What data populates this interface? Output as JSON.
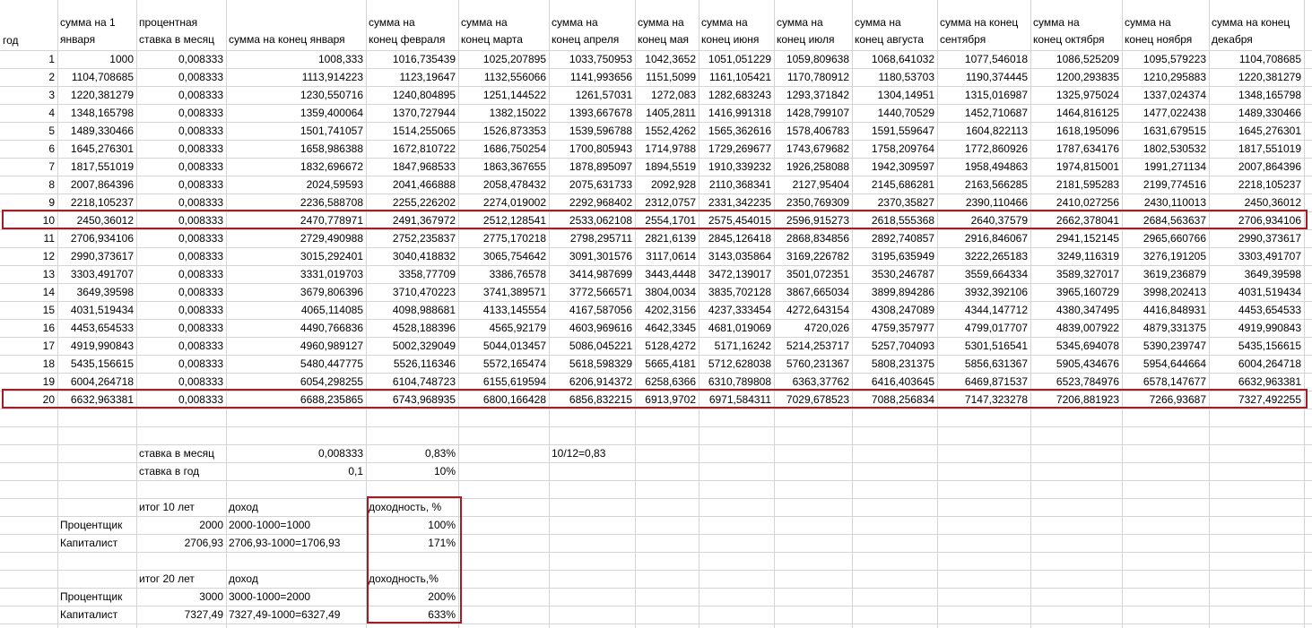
{
  "header": {
    "year": "год",
    "start": [
      "сумма на 1",
      "января"
    ],
    "rate": [
      "процентная",
      "ставка в месяц"
    ],
    "jan": [
      "",
      "сумма на конец января"
    ],
    "months": [
      [
        "сумма на",
        "конец февраля"
      ],
      [
        "сумма на",
        "конец марта"
      ],
      [
        "сумма на",
        "конец апреля"
      ],
      [
        "сумма на",
        "конец мая"
      ],
      [
        "сумма на",
        "конец июня"
      ],
      [
        "сумма на",
        "конец июля"
      ],
      [
        "сумма на",
        "конец августа"
      ],
      [
        "сумма на конец",
        "сентября"
      ],
      [
        "сумма на",
        "конец октября"
      ],
      [
        "сумма на",
        "конец ноября"
      ],
      [
        "сумма на конец",
        "декабря"
      ]
    ]
  },
  "rows": [
    [
      "1",
      "1000",
      "0,008333",
      "1008,333",
      "1016,735439",
      "1025,207895",
      "1033,750953",
      "1042,3652",
      "1051,051229",
      "1059,809638",
      "1068,641032",
      "1077,546018",
      "1086,525209",
      "1095,579223",
      "1104,708685"
    ],
    [
      "2",
      "1104,708685",
      "0,008333",
      "1113,914223",
      "1123,19647",
      "1132,556066",
      "1141,993656",
      "1151,5099",
      "1161,105421",
      "1170,780912",
      "1180,53703",
      "1190,374445",
      "1200,293835",
      "1210,295883",
      "1220,381279"
    ],
    [
      "3",
      "1220,381279",
      "0,008333",
      "1230,550716",
      "1240,804895",
      "1251,144522",
      "1261,57031",
      "1272,083",
      "1282,683243",
      "1293,371842",
      "1304,14951",
      "1315,016987",
      "1325,975024",
      "1337,024374",
      "1348,165798"
    ],
    [
      "4",
      "1348,165798",
      "0,008333",
      "1359,400064",
      "1370,727944",
      "1382,15022",
      "1393,667678",
      "1405,2811",
      "1416,991318",
      "1428,799107",
      "1440,70529",
      "1452,710687",
      "1464,816125",
      "1477,022438",
      "1489,330466"
    ],
    [
      "5",
      "1489,330466",
      "0,008333",
      "1501,741057",
      "1514,255065",
      "1526,873353",
      "1539,596788",
      "1552,4262",
      "1565,362616",
      "1578,406783",
      "1591,559647",
      "1604,822113",
      "1618,195096",
      "1631,679515",
      "1645,276301"
    ],
    [
      "6",
      "1645,276301",
      "0,008333",
      "1658,986388",
      "1672,810722",
      "1686,750254",
      "1700,805943",
      "1714,9788",
      "1729,269677",
      "1743,679682",
      "1758,209764",
      "1772,860926",
      "1787,634176",
      "1802,530532",
      "1817,551019"
    ],
    [
      "7",
      "1817,551019",
      "0,008333",
      "1832,696672",
      "1847,968533",
      "1863,367655",
      "1878,895097",
      "1894,5519",
      "1910,339232",
      "1926,258088",
      "1942,309597",
      "1958,494863",
      "1974,815001",
      "1991,271134",
      "2007,864396"
    ],
    [
      "8",
      "2007,864396",
      "0,008333",
      "2024,59593",
      "2041,466888",
      "2058,478432",
      "2075,631733",
      "2092,928",
      "2110,368341",
      "2127,95404",
      "2145,686281",
      "2163,566285",
      "2181,595283",
      "2199,774516",
      "2218,105237"
    ],
    [
      "9",
      "2218,105237",
      "0,008333",
      "2236,588708",
      "2255,226202",
      "2274,019002",
      "2292,968402",
      "2312,0757",
      "2331,342235",
      "2350,769309",
      "2370,35827",
      "2390,110466",
      "2410,027256",
      "2430,110013",
      "2450,36012"
    ],
    [
      "10",
      "2450,36012",
      "0,008333",
      "2470,778971",
      "2491,367972",
      "2512,128541",
      "2533,062108",
      "2554,1701",
      "2575,454015",
      "2596,915273",
      "2618,555368",
      "2640,37579",
      "2662,378041",
      "2684,563637",
      "2706,934106"
    ],
    [
      "11",
      "2706,934106",
      "0,008333",
      "2729,490988",
      "2752,235837",
      "2775,170218",
      "2798,295711",
      "2821,6139",
      "2845,126418",
      "2868,834856",
      "2892,740857",
      "2916,846067",
      "2941,152145",
      "2965,660766",
      "2990,373617"
    ],
    [
      "12",
      "2990,373617",
      "0,008333",
      "3015,292401",
      "3040,418832",
      "3065,754642",
      "3091,301576",
      "3117,0614",
      "3143,035864",
      "3169,226782",
      "3195,635949",
      "3222,265183",
      "3249,116319",
      "3276,191205",
      "3303,491707"
    ],
    [
      "13",
      "3303,491707",
      "0,008333",
      "3331,019703",
      "3358,77709",
      "3386,76578",
      "3414,987699",
      "3443,4448",
      "3472,139017",
      "3501,072351",
      "3530,246787",
      "3559,664334",
      "3589,327017",
      "3619,236879",
      "3649,39598"
    ],
    [
      "14",
      "3649,39598",
      "0,008333",
      "3679,806396",
      "3710,470223",
      "3741,389571",
      "3772,566571",
      "3804,0034",
      "3835,702128",
      "3867,665034",
      "3899,894286",
      "3932,392106",
      "3965,160729",
      "3998,202413",
      "4031,519434"
    ],
    [
      "15",
      "4031,519434",
      "0,008333",
      "4065,114085",
      "4098,988681",
      "4133,145554",
      "4167,587056",
      "4202,3156",
      "4237,333454",
      "4272,643154",
      "4308,247089",
      "4344,147712",
      "4380,347495",
      "4416,848931",
      "4453,654533"
    ],
    [
      "16",
      "4453,654533",
      "0,008333",
      "4490,766836",
      "4528,188396",
      "4565,92179",
      "4603,969616",
      "4642,3345",
      "4681,019069",
      "4720,026",
      "4759,357977",
      "4799,017707",
      "4839,007922",
      "4879,331375",
      "4919,990843"
    ],
    [
      "17",
      "4919,990843",
      "0,008333",
      "4960,989127",
      "5002,329049",
      "5044,013457",
      "5086,045221",
      "5128,4272",
      "5171,16242",
      "5214,253717",
      "5257,704093",
      "5301,516541",
      "5345,694078",
      "5390,239747",
      "5435,156615"
    ],
    [
      "18",
      "5435,156615",
      "0,008333",
      "5480,447775",
      "5526,116346",
      "5572,165474",
      "5618,598329",
      "5665,4181",
      "5712,628038",
      "5760,231367",
      "5808,231375",
      "5856,631367",
      "5905,434676",
      "5954,644664",
      "6004,264718"
    ],
    [
      "19",
      "6004,264718",
      "0,008333",
      "6054,298255",
      "6104,748723",
      "6155,619594",
      "6206,914372",
      "6258,6366",
      "6310,789808",
      "6363,37762",
      "6416,403645",
      "6469,871537",
      "6523,784976",
      "6578,147677",
      "6632,963381"
    ],
    [
      "20",
      "6632,963381",
      "0,008333",
      "6688,235865",
      "6743,968935",
      "6800,166428",
      "6856,832215",
      "6913,9702",
      "6971,584311",
      "7029,678523",
      "7088,256834",
      "7147,323278",
      "7206,881923",
      "7266,93687",
      "7327,492255"
    ]
  ],
  "highlighted_years": [
    "10",
    "20"
  ],
  "summary": {
    "rate_month_label": "ставка в месяц",
    "rate_month_value": "0,008333",
    "rate_month_pct": "0,83%",
    "rate_note": "10/12=0,83",
    "rate_year_label": "ставка в год",
    "rate_year_value": "0,1",
    "rate_year_pct": "10%",
    "block10": {
      "total_label": "итог 10 лет",
      "income_label": "доход",
      "yield_label": "доходность, %",
      "rows": [
        {
          "name": "Процентщик",
          "total": "2000",
          "income": "2000-1000=1000",
          "yield": "100%"
        },
        {
          "name": "Капиталист",
          "total": "2706,93",
          "income": "2706,93-1000=1706,93",
          "yield": "171%"
        }
      ]
    },
    "block20": {
      "total_label": "итог 20 лет",
      "income_label": "доход",
      "yield_label": "доходность,%",
      "rows": [
        {
          "name": "Процентщик",
          "total": "3000",
          "income": "3000-1000=2000",
          "yield": "200%"
        },
        {
          "name": "Капиталист",
          "total": "7327,49",
          "income": "7327,49-1000=6327,49",
          "yield": "633%"
        }
      ]
    }
  },
  "colors": {
    "grid": "#d4d4d4",
    "highlight_border": "#a31d27"
  }
}
